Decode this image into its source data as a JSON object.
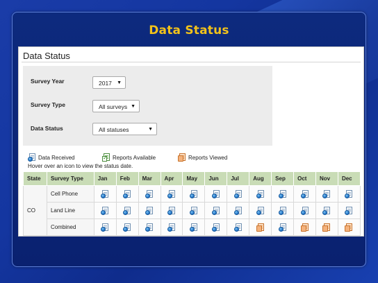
{
  "page": {
    "title": "Data Status"
  },
  "panel": {
    "title": "Data Status"
  },
  "filters": {
    "survey_year": {
      "label": "Survey Year",
      "value": "2017"
    },
    "survey_type": {
      "label": "Survey Type",
      "value": "All surveys"
    },
    "data_status": {
      "label": "Data Status",
      "value": "All statuses"
    }
  },
  "legend": {
    "received": {
      "label": "Data Received",
      "icon": "data-received-icon"
    },
    "reports": {
      "label": "Reports Available",
      "icon": "reports-available-icon"
    },
    "viewed": {
      "label": "Reports Viewed",
      "icon": "reports-viewed-icon"
    }
  },
  "hint": "Hover over an icon to view the status date.",
  "table": {
    "headers": [
      "State",
      "Survey Type",
      "Jan",
      "Feb",
      "Mar",
      "Apr",
      "May",
      "Jun",
      "Jul",
      "Aug",
      "Sep",
      "Oct",
      "Nov",
      "Dec"
    ],
    "state": "CO",
    "rows": [
      {
        "survey_type": "Cell Phone",
        "months": [
          "received",
          "received",
          "received",
          "received",
          "received",
          "received",
          "received",
          "received",
          "received",
          "received",
          "received",
          "received"
        ]
      },
      {
        "survey_type": "Land Line",
        "months": [
          "received",
          "received",
          "received",
          "received",
          "received",
          "received",
          "received",
          "received",
          "received",
          "received",
          "received",
          "received"
        ]
      },
      {
        "survey_type": "Combined",
        "months": [
          "received",
          "received",
          "received",
          "received",
          "received",
          "received",
          "received",
          "viewed",
          "received",
          "viewed",
          "viewed",
          "viewed"
        ]
      }
    ]
  },
  "colors": {
    "title": "#f2c21a",
    "header_bg": "#c9dcb6",
    "filter_bg": "#ececec",
    "frame_bg": "#0d2a7e"
  }
}
